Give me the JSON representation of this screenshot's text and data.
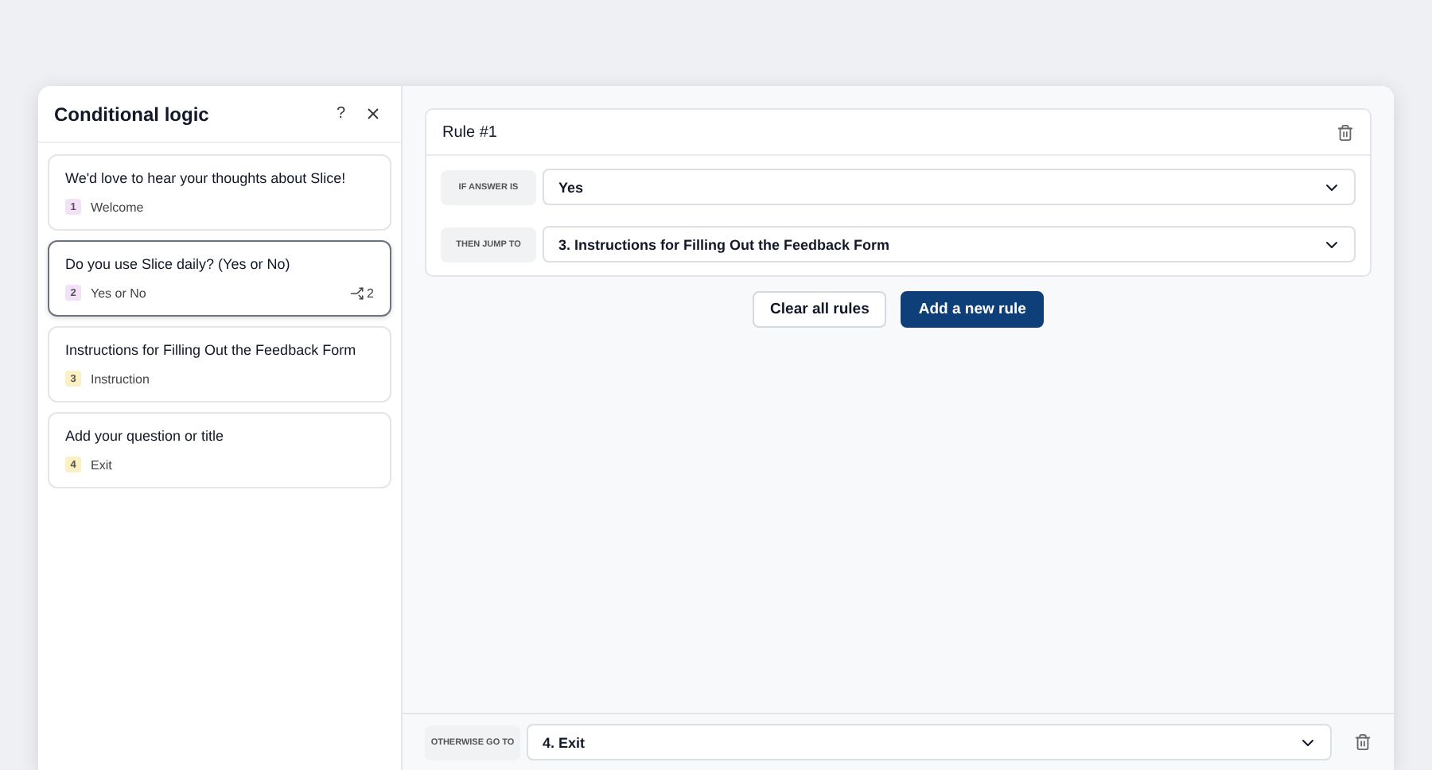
{
  "dialog": {
    "title": "Conditional logic",
    "help": "?"
  },
  "questions": [
    {
      "title": "We'd love to hear your thoughts about Slice!",
      "number": "1",
      "type": "Welcome",
      "color": "#f3e2f7",
      "selected": false
    },
    {
      "title": "Do you use Slice daily? (Yes or No)",
      "number": "2",
      "type": "Yes or No",
      "color": "#f3e2f7",
      "selected": true,
      "rule_count": "2"
    },
    {
      "title": "Instructions for Filling Out the Feedback Form",
      "number": "3",
      "type": "Instruction",
      "color": "#fbf0c4",
      "selected": false
    },
    {
      "title": "Add your question or title",
      "number": "4",
      "type": "Exit",
      "color": "#fbf0c4",
      "selected": false
    }
  ],
  "rules": [
    {
      "title": "Rule #1",
      "conditions": [
        {
          "label": "IF ANSWER IS",
          "value": "Yes"
        },
        {
          "label": "THEN JUMP TO",
          "value": "3. Instructions for Filling Out the Feedback Form"
        }
      ]
    }
  ],
  "actions": {
    "clear": "Clear all rules",
    "add": "Add a new rule"
  },
  "otherwise": {
    "label": "OTHERWISE GO TO",
    "value": "4. Exit"
  }
}
